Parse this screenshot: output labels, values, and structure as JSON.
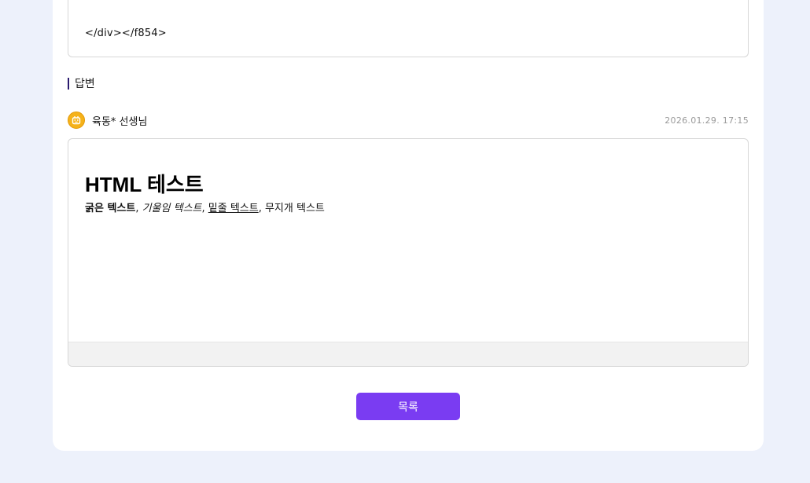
{
  "question": {
    "code_text": "</div></f854>"
  },
  "answer": {
    "heading": "답변",
    "author": "육동* 선생님",
    "date": "2026.01.29. 17:15",
    "title": "HTML 테스트",
    "bold_text": "굵은 텍스트",
    "italic_text": "기울임 텍스트",
    "underline_text": "밑줄 텍스트",
    "rainbow_text": "무지개 텍스트",
    "separator": ", "
  },
  "actions": {
    "list_label": "목록"
  },
  "colors": {
    "page_background": "#edf1fb",
    "accent": "#7a3cf2",
    "avatar": "#f5b21a",
    "heading_bar": "#2a1a6e"
  },
  "icons": {
    "avatar": "teacher-avatar-icon"
  }
}
